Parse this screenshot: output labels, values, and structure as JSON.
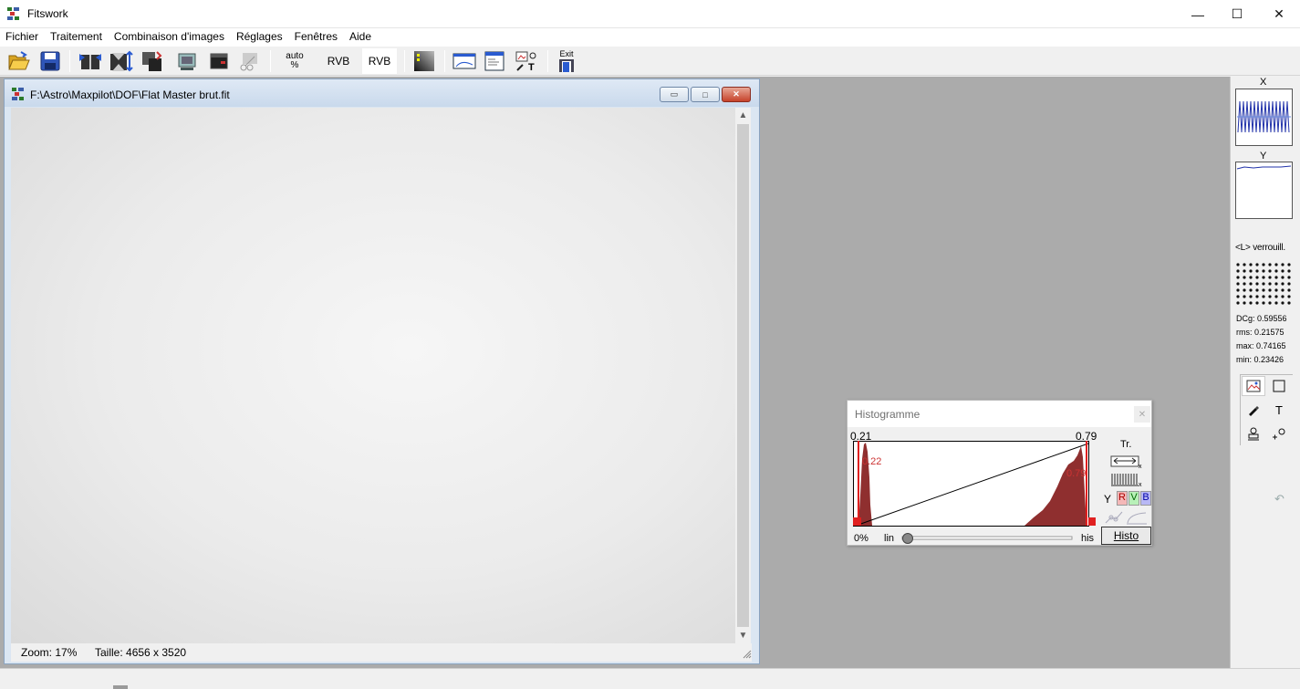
{
  "window": {
    "title": "Fitswork",
    "minimize_glyph": "—",
    "maximize_glyph": "☐",
    "close_glyph": "✕"
  },
  "menu": [
    "Fichier",
    "Traitement",
    "Combinaison d'images",
    "Réglages",
    "Fenêtres",
    "Aide"
  ],
  "toolbar": {
    "open_icon": "folder-open-icon",
    "save_icon": "floppy-save-icon",
    "auto_top": "auto",
    "auto_bottom": "%",
    "rvb1": "RVB",
    "rvb2": "RVB",
    "exit_label": "Exit"
  },
  "child": {
    "title": "F:\\Astro\\Maxpilot\\DOF\\Flat Master brut.fit",
    "zoom": "Zoom: 17%",
    "size": "Taille: 4656 x 3520",
    "scroll_up": "▲",
    "scroll_down": "▼",
    "min_glyph": "▭",
    "max_glyph": "□",
    "close_glyph": "✕"
  },
  "histogram": {
    "title": "Histogramme",
    "close_glyph": "✕",
    "left_value": "0.21",
    "right_value": "0.79",
    "left_marker": "0.22",
    "right_marker": "0.79",
    "percent": "0%",
    "lin": "lin",
    "his": "his",
    "tr_label": "Tr.",
    "channel_y": "Y",
    "channel_r": "R",
    "channel_v": "V",
    "channel_b": "B",
    "histo_button": "Histo",
    "colors": {
      "bars": "#8f2f2f",
      "marker": "#e02020",
      "r_bg": "#f4b8b8",
      "v_bg": "#b8f0b8",
      "b_bg": "#b8b8f4"
    }
  },
  "right_panel": {
    "x_label": "X",
    "y_label": "Y",
    "lock_label": "<L> verrouill.",
    "dcg": "DCg: 0.59556",
    "rms": "rms: 0.21575",
    "max": "max: 0.74165",
    "min": "min: 0.23426",
    "text_tool": "T",
    "undo_glyph": "↶"
  }
}
